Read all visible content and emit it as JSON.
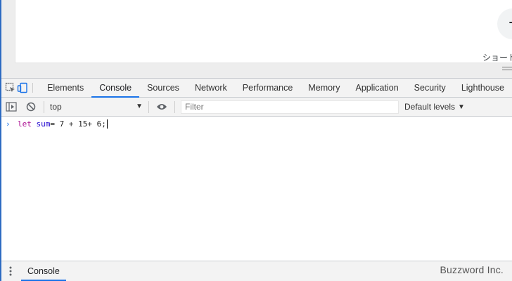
{
  "page": {
    "shortcut_label": "ショート",
    "add_icon": "plus-icon"
  },
  "devtools": {
    "tabs": [
      {
        "label": "Elements",
        "active": false
      },
      {
        "label": "Console",
        "active": true
      },
      {
        "label": "Sources",
        "active": false
      },
      {
        "label": "Network",
        "active": false
      },
      {
        "label": "Performance",
        "active": false
      },
      {
        "label": "Memory",
        "active": false
      },
      {
        "label": "Application",
        "active": false
      },
      {
        "label": "Security",
        "active": false
      },
      {
        "label": "Lighthouse",
        "active": false
      }
    ],
    "accent_color": "#1a73e8"
  },
  "console_toolbar": {
    "context": "top",
    "filter_placeholder": "Filter",
    "levels": "Default levels"
  },
  "console": {
    "input": {
      "keyword": "let",
      "variable": "sum",
      "expression": " = 7 + 15+ 6;"
    }
  },
  "drawer": {
    "tab": "Console"
  },
  "watermark": "Buzzword Inc."
}
